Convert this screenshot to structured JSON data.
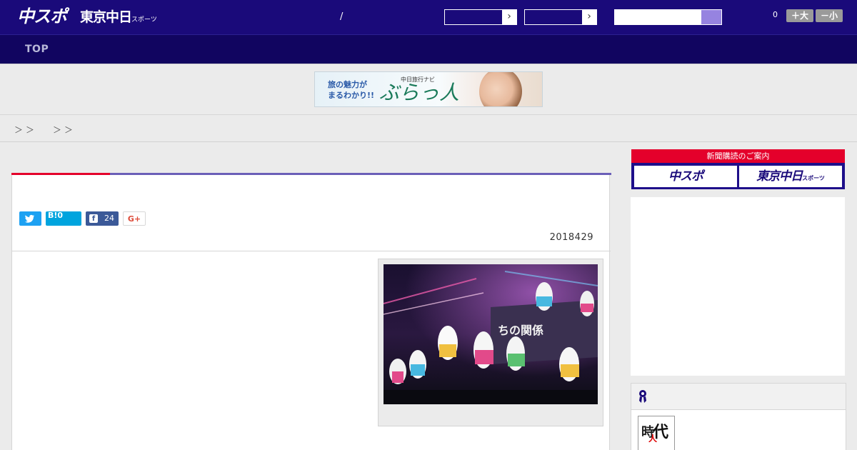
{
  "header": {
    "logo_chunichi": "中スポ",
    "logo_tokyo": "東京中日",
    "logo_tokyo_sub": "スポーツ",
    "separator": "/",
    "select1_arrow": "›",
    "select2_arrow": "›",
    "search_placeholder": "",
    "count": "0",
    "font_large": "＋大",
    "font_small": "－小"
  },
  "nav": {
    "top": "TOP"
  },
  "banner": {
    "line1": "旅の魅力が",
    "line2": "まるわかり!!",
    "small": "中日旅行ナビ",
    "logo": "ぶらっ人"
  },
  "breadcrumb": {
    "sep1": "＞＞",
    "sep2": "＞＞"
  },
  "article": {
    "hatena_label": "B!0",
    "facebook_count": "24",
    "google_label": "G+",
    "date": "2018429"
  },
  "sidebar": {
    "subscribe_head": "新聞購読のご案内",
    "sub_btn1": "中スポ",
    "sub_btn2": "東京中日",
    "sub_btn2_small": "スポーツ",
    "thumb_k1": "時",
    "thumb_k2": "代",
    "thumb_k3": "人"
  },
  "colors": {
    "header_bg": "#1a0a7a",
    "nav_bg": "#110560",
    "accent_red": "#e4002b",
    "accent_purple": "#6b5fb8",
    "twitter": "#1da1f2",
    "hatena": "#00a4de",
    "facebook": "#3b5998"
  },
  "icons": {
    "twitter": "twitter-bird-icon",
    "facebook": "facebook-f-icon",
    "ranking": "ribbon-badge-icon"
  }
}
